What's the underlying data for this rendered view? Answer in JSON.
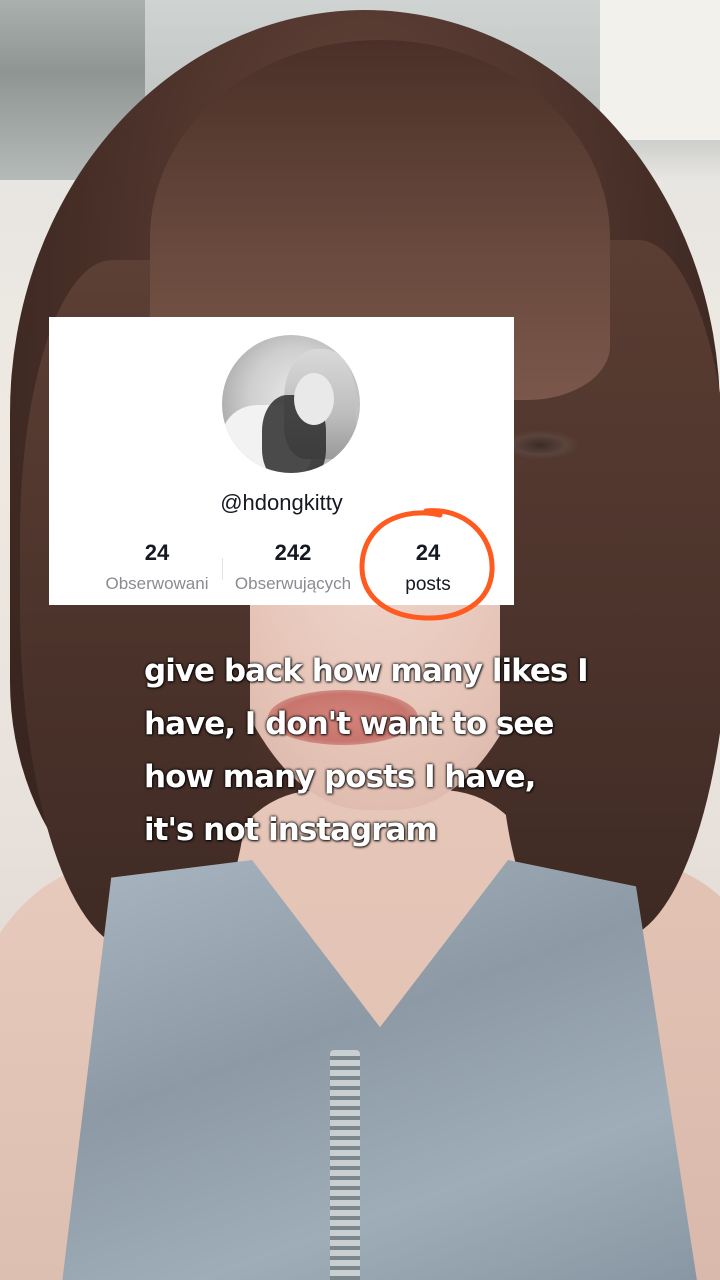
{
  "profile": {
    "username": "@hdongkitty",
    "stats": [
      {
        "value": "24",
        "label": "Obserwowani"
      },
      {
        "value": "242",
        "label": "Obserwujących"
      },
      {
        "value": "24",
        "label": "posts"
      }
    ]
  },
  "caption": {
    "lines": [
      "give back how many likes I",
      "have, I don't want to see",
      "how many posts I have,",
      "it's not instagram"
    ]
  },
  "colors": {
    "highlight_circle": "#ff5a1f",
    "card_background": "#ffffff",
    "caption_text": "#ffffff"
  }
}
